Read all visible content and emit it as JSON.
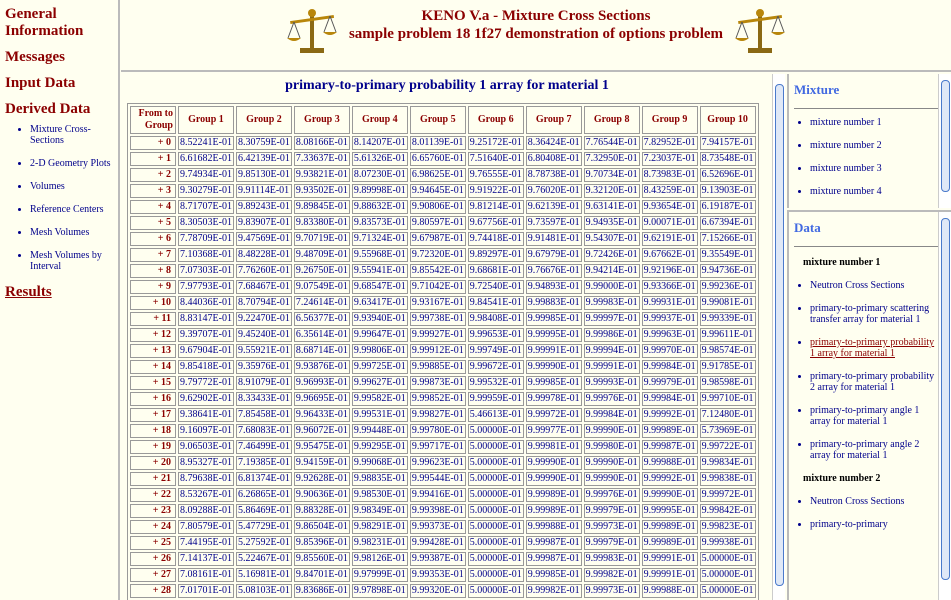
{
  "nav": {
    "general": "General Information",
    "messages": "Messages",
    "input": "Input Data",
    "derived": "Derived Data",
    "derived_items": [
      "Mixture Cross-Sections",
      "2-D Geometry Plots",
      "Volumes",
      "Reference Centers",
      "Mesh Volumes",
      "Mesh Volumes by Interval"
    ],
    "results": "Results"
  },
  "header": {
    "title": "KENO V.a - Mixture Cross Sections",
    "subtitle": "sample problem 18 1f27 demonstration of options problem"
  },
  "main": {
    "title": "primary-to-primary probability 1 array for material 1",
    "from_header": "From to Group",
    "columns": [
      "Group 1",
      "Group 2",
      "Group 3",
      "Group 4",
      "Group 5",
      "Group 6",
      "Group 7",
      "Group 8",
      "Group 9",
      "Group 10"
    ],
    "rows": [
      {
        "label": "+ 0",
        "values": [
          "8.52241E-01",
          "8.30759E-01",
          "8.08166E-01",
          "8.14207E-01",
          "8.01139E-01",
          "9.25172E-01",
          "8.36424E-01",
          "7.76544E-01",
          "7.82952E-01",
          "7.94157E-01"
        ]
      },
      {
        "label": "+ 1",
        "values": [
          "6.61682E-01",
          "6.42139E-01",
          "7.33637E-01",
          "5.61326E-01",
          "6.65760E-01",
          "7.51640E-01",
          "6.80408E-01",
          "7.32950E-01",
          "7.23037E-01",
          "8.73548E-01"
        ]
      },
      {
        "label": "+ 2",
        "values": [
          "9.74934E-01",
          "9.85130E-01",
          "9.93821E-01",
          "8.07230E-01",
          "6.98625E-01",
          "9.76555E-01",
          "8.78738E-01",
          "9.70734E-01",
          "8.73983E-01",
          "6.52696E-01"
        ]
      },
      {
        "label": "+ 3",
        "values": [
          "9.30279E-01",
          "9.91114E-01",
          "9.93502E-01",
          "9.89998E-01",
          "9.94645E-01",
          "9.91922E-01",
          "9.76020E-01",
          "9.32120E-01",
          "8.43259E-01",
          "9.13903E-01"
        ]
      },
      {
        "label": "+ 4",
        "values": [
          "8.71707E-01",
          "9.89243E-01",
          "9.89845E-01",
          "9.88632E-01",
          "9.90806E-01",
          "9.81214E-01",
          "9.62139E-01",
          "9.63141E-01",
          "9.93654E-01",
          "6.19187E-01"
        ]
      },
      {
        "label": "+ 5",
        "values": [
          "8.30503E-01",
          "9.83907E-01",
          "9.83380E-01",
          "9.83573E-01",
          "9.80597E-01",
          "9.67756E-01",
          "9.73597E-01",
          "9.94935E-01",
          "9.00071E-01",
          "6.67394E-01"
        ]
      },
      {
        "label": "+ 6",
        "values": [
          "7.78709E-01",
          "9.47569E-01",
          "9.70719E-01",
          "9.71324E-01",
          "9.67987E-01",
          "9.74418E-01",
          "9.91481E-01",
          "9.54307E-01",
          "9.62191E-01",
          "7.15266E-01"
        ]
      },
      {
        "label": "+ 7",
        "values": [
          "7.10368E-01",
          "8.48228E-01",
          "9.48709E-01",
          "9.55968E-01",
          "9.72320E-01",
          "9.89297E-01",
          "9.67979E-01",
          "9.72426E-01",
          "9.67662E-01",
          "9.35549E-01"
        ]
      },
      {
        "label": "+ 8",
        "values": [
          "7.07303E-01",
          "7.76260E-01",
          "9.26750E-01",
          "9.55941E-01",
          "9.85542E-01",
          "9.68681E-01",
          "9.76676E-01",
          "9.94214E-01",
          "9.92196E-01",
          "9.94736E-01"
        ]
      },
      {
        "label": "+ 9",
        "values": [
          "7.97793E-01",
          "7.68467E-01",
          "9.07549E-01",
          "9.68547E-01",
          "9.71042E-01",
          "9.72540E-01",
          "9.94893E-01",
          "9.99000E-01",
          "9.93366E-01",
          "9.99236E-01"
        ]
      },
      {
        "label": "+ 10",
        "values": [
          "8.44036E-01",
          "8.70794E-01",
          "7.24614E-01",
          "9.63417E-01",
          "9.93167E-01",
          "9.84541E-01",
          "9.99883E-01",
          "9.99983E-01",
          "9.99931E-01",
          "9.99081E-01"
        ]
      },
      {
        "label": "+ 11",
        "values": [
          "8.83147E-01",
          "9.22470E-01",
          "6.56377E-01",
          "9.93940E-01",
          "9.99738E-01",
          "9.98408E-01",
          "9.99985E-01",
          "9.99997E-01",
          "9.99937E-01",
          "9.99339E-01"
        ]
      },
      {
        "label": "+ 12",
        "values": [
          "9.39707E-01",
          "9.45240E-01",
          "6.35614E-01",
          "9.99647E-01",
          "9.99927E-01",
          "9.99653E-01",
          "9.99995E-01",
          "9.99986E-01",
          "9.99963E-01",
          "9.99611E-01"
        ]
      },
      {
        "label": "+ 13",
        "values": [
          "9.67904E-01",
          "9.55921E-01",
          "8.68714E-01",
          "9.99806E-01",
          "9.99912E-01",
          "9.99749E-01",
          "9.99991E-01",
          "9.99994E-01",
          "9.99970E-01",
          "9.98574E-01"
        ]
      },
      {
        "label": "+ 14",
        "values": [
          "9.85418E-01",
          "9.35976E-01",
          "9.93876E-01",
          "9.99725E-01",
          "9.99885E-01",
          "9.99672E-01",
          "9.99990E-01",
          "9.99991E-01",
          "9.99984E-01",
          "9.91785E-01"
        ]
      },
      {
        "label": "+ 15",
        "values": [
          "9.79772E-01",
          "8.91079E-01",
          "9.96993E-01",
          "9.99627E-01",
          "9.99873E-01",
          "9.99532E-01",
          "9.99985E-01",
          "9.99993E-01",
          "9.99979E-01",
          "9.98598E-01"
        ]
      },
      {
        "label": "+ 16",
        "values": [
          "9.62902E-01",
          "8.33433E-01",
          "9.96695E-01",
          "9.99582E-01",
          "9.99852E-01",
          "9.99959E-01",
          "9.99978E-01",
          "9.99976E-01",
          "9.99984E-01",
          "9.99710E-01"
        ]
      },
      {
        "label": "+ 17",
        "values": [
          "9.38641E-01",
          "7.85458E-01",
          "9.96433E-01",
          "9.99531E-01",
          "9.99827E-01",
          "5.46613E-01",
          "9.99972E-01",
          "9.99984E-01",
          "9.99992E-01",
          "7.12480E-01"
        ]
      },
      {
        "label": "+ 18",
        "values": [
          "9.16097E-01",
          "7.68083E-01",
          "9.96072E-01",
          "9.99448E-01",
          "9.99780E-01",
          "5.00000E-01",
          "9.99977E-01",
          "9.99990E-01",
          "9.99989E-01",
          "5.73969E-01"
        ]
      },
      {
        "label": "+ 19",
        "values": [
          "9.06503E-01",
          "7.46499E-01",
          "9.95475E-01",
          "9.99295E-01",
          "9.99717E-01",
          "5.00000E-01",
          "9.99981E-01",
          "9.99980E-01",
          "9.99987E-01",
          "9.99722E-01"
        ]
      },
      {
        "label": "+ 20",
        "values": [
          "8.95327E-01",
          "7.19385E-01",
          "9.94159E-01",
          "9.99068E-01",
          "9.99623E-01",
          "5.00000E-01",
          "9.99990E-01",
          "9.99990E-01",
          "9.99988E-01",
          "9.99834E-01"
        ]
      },
      {
        "label": "+ 21",
        "values": [
          "8.79638E-01",
          "6.81374E-01",
          "9.92628E-01",
          "9.98835E-01",
          "9.99544E-01",
          "5.00000E-01",
          "9.99990E-01",
          "9.99990E-01",
          "9.99992E-01",
          "9.99838E-01"
        ]
      },
      {
        "label": "+ 22",
        "values": [
          "8.53267E-01",
          "6.26865E-01",
          "9.90636E-01",
          "9.98530E-01",
          "9.99416E-01",
          "5.00000E-01",
          "9.99989E-01",
          "9.99976E-01",
          "9.99990E-01",
          "9.99972E-01"
        ]
      },
      {
        "label": "+ 23",
        "values": [
          "8.09288E-01",
          "5.86469E-01",
          "9.88328E-01",
          "9.98349E-01",
          "9.99398E-01",
          "5.00000E-01",
          "9.99989E-01",
          "9.99979E-01",
          "9.99995E-01",
          "9.99842E-01"
        ]
      },
      {
        "label": "+ 24",
        "values": [
          "7.80579E-01",
          "5.47729E-01",
          "9.86504E-01",
          "9.98291E-01",
          "9.99373E-01",
          "5.00000E-01",
          "9.99988E-01",
          "9.99973E-01",
          "9.99989E-01",
          "9.99823E-01"
        ]
      },
      {
        "label": "+ 25",
        "values": [
          "7.44195E-01",
          "5.27592E-01",
          "9.85396E-01",
          "9.98231E-01",
          "9.99428E-01",
          "5.00000E-01",
          "9.99987E-01",
          "9.99979E-01",
          "9.99989E-01",
          "9.99938E-01"
        ]
      },
      {
        "label": "+ 26",
        "values": [
          "7.14137E-01",
          "5.22467E-01",
          "9.85560E-01",
          "9.98126E-01",
          "9.99387E-01",
          "5.00000E-01",
          "9.99987E-01",
          "9.99983E-01",
          "9.99991E-01",
          "5.00000E-01"
        ]
      },
      {
        "label": "+ 27",
        "values": [
          "7.08161E-01",
          "5.16981E-01",
          "9.84701E-01",
          "9.97999E-01",
          "9.99353E-01",
          "5.00000E-01",
          "9.99985E-01",
          "9.99982E-01",
          "9.99991E-01",
          "5.00000E-01"
        ]
      },
      {
        "label": "+ 28",
        "values": [
          "7.01701E-01",
          "5.08103E-01",
          "9.83686E-01",
          "9.97898E-01",
          "9.99320E-01",
          "5.00000E-01",
          "9.99982E-01",
          "9.99973E-01",
          "9.99988E-01",
          "5.00000E-01"
        ]
      }
    ]
  },
  "mixture": {
    "title": "Mixture",
    "items": [
      "mixture number 1",
      "mixture number 2",
      "mixture number 3",
      "mixture number 4"
    ]
  },
  "data_panel": {
    "title": "Data",
    "mix1_header": "mixture number 1",
    "mix1_items": [
      "Neutron Cross Sections",
      "primary-to-primary scattering transfer array for material 1",
      "primary-to-primary probability 1 array for material 1",
      "primary-to-primary probability 2 array for material 1",
      "primary-to-primary angle 1 array for material 1",
      "primary-to-primary angle 2 array for material 1"
    ],
    "mix2_header": "mixture number 2",
    "mix2_items": [
      "Neutron Cross Sections",
      "primary-to-primary"
    ]
  },
  "colors": {
    "link": "#00008b",
    "heading": "#8b0000",
    "accent": "#4169e1",
    "background": "#fffff0"
  }
}
